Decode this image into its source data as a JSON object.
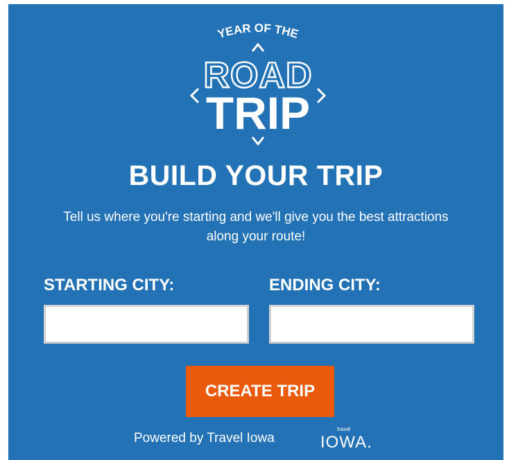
{
  "colors": {
    "panel": "#2372b5",
    "button": "#ea5a0d",
    "text": "#ffffff"
  },
  "logo": {
    "top_arc": "YEAR OF THE",
    "line1": "ROAD",
    "line2": "TRIP",
    "icon": "compass-arrows-icon"
  },
  "headline": "BUILD YOUR TRIP",
  "subtext": "Tell us where you're starting and we'll give you the best attractions along your route!",
  "form": {
    "starting_label": "STARTING CITY:",
    "starting_value": "",
    "ending_label": "ENDING CITY:",
    "ending_value": "",
    "submit_label": "CREATE TRIP"
  },
  "footer": {
    "powered_by": "Powered by Travel Iowa",
    "brand_small": "travel",
    "brand_large": "IOWA."
  }
}
